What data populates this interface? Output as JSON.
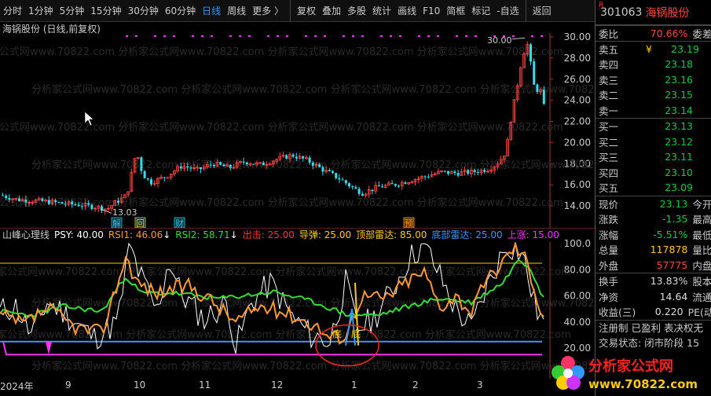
{
  "toolbar": {
    "items": [
      "分时",
      "1分钟",
      "5分钟",
      "15分钟",
      "30分钟",
      "60分钟",
      "日线",
      "周线",
      "更多 〉",
      "复权",
      "叠加",
      "多股",
      "统计",
      "画线",
      "F10",
      "简框",
      "标记",
      "-自选",
      "返回"
    ],
    "active_index": 6
  },
  "chart": {
    "title": "海锅股份 (日线,前复权)",
    "high_label": "30.00",
    "low_label": "13.03",
    "price_ticks": [
      "30.00",
      "28.00",
      "26.00",
      "24.00",
      "22.00",
      "20.00",
      "18.00",
      "16.00",
      "14.00"
    ],
    "watermark": "分析家公式网www.70822.com",
    "event_marks": [
      "解",
      "回",
      "财",
      "预"
    ]
  },
  "indicator": {
    "name": "山峰心理线",
    "psy_label": "PSY:",
    "psy": "40.00",
    "rsi1_label": "RSI1:",
    "rsi1": "46.06",
    "rsi2_label": "RSI2:",
    "rsi2": "58.71",
    "out_label": "出击:",
    "out": "25.00",
    "missile_label": "导弹:",
    "missile": "25.00",
    "top_label": "顶部雷达:",
    "top": "85.00",
    "bottom_label": "底部雷达:",
    "bottom": "25.00",
    "up_label": "上涨:",
    "up": "15.00",
    "ticks": [
      "100.0",
      "80.00",
      "60.00",
      "40.00",
      "20.00"
    ],
    "annot": [
      "底",
      "底"
    ]
  },
  "dates": [
    "2024年",
    "9",
    "10",
    "11",
    "12",
    "1",
    "2",
    "3"
  ],
  "quote": {
    "rtag": "R",
    "code": "301063",
    "name": "海锅股份",
    "webi_label": "委比",
    "webi": "70.66%",
    "webi_extra": "委差",
    "asks": [
      {
        "l": "卖五",
        "v": "23.19",
        "x": ""
      },
      {
        "l": "卖四",
        "v": "23.18",
        "x": ""
      },
      {
        "l": "卖三",
        "v": "23.16",
        "x": ""
      },
      {
        "l": "卖二",
        "v": "23.15",
        "x": ""
      },
      {
        "l": "卖一",
        "v": "23.14",
        "x": ""
      }
    ],
    "ask5_mark": "¥",
    "bids": [
      {
        "l": "买一",
        "v": "23.13",
        "x": ""
      },
      {
        "l": "买二",
        "v": "23.12",
        "x": ""
      },
      {
        "l": "买三",
        "v": "23.11",
        "x": ""
      },
      {
        "l": "买四",
        "v": "23.10",
        "x": ""
      },
      {
        "l": "买五",
        "v": "23.09",
        "x": ""
      }
    ],
    "stats": [
      {
        "l": "现价",
        "v": "23.13",
        "x": "今开",
        "c": "g"
      },
      {
        "l": "涨跌",
        "v": "-1.35",
        "x": "最高",
        "c": "g"
      },
      {
        "l": "涨幅",
        "v": "-5.51%",
        "x": "最低",
        "c": "g"
      },
      {
        "l": "总量",
        "v": "117878",
        "x": "量比",
        "c": "y"
      },
      {
        "l": "外盘",
        "v": "57775",
        "x": "内盘",
        "c": "r"
      }
    ],
    "stats2": [
      {
        "l": "换手",
        "v": "13.83%",
        "x": "股本",
        "c": "w"
      },
      {
        "l": "净资",
        "v": "14.64",
        "x": "流通",
        "c": "w"
      },
      {
        "l": "收益(三)",
        "v": "0.220",
        "x": "PE(动",
        "c": "w"
      }
    ],
    "regline": "注册制  已盈利  表决权无",
    "status": "交易状态: 闭市阶段  15"
  },
  "logo": {
    "line1": "分析家公式网",
    "line2": "www.70822.com"
  }
}
